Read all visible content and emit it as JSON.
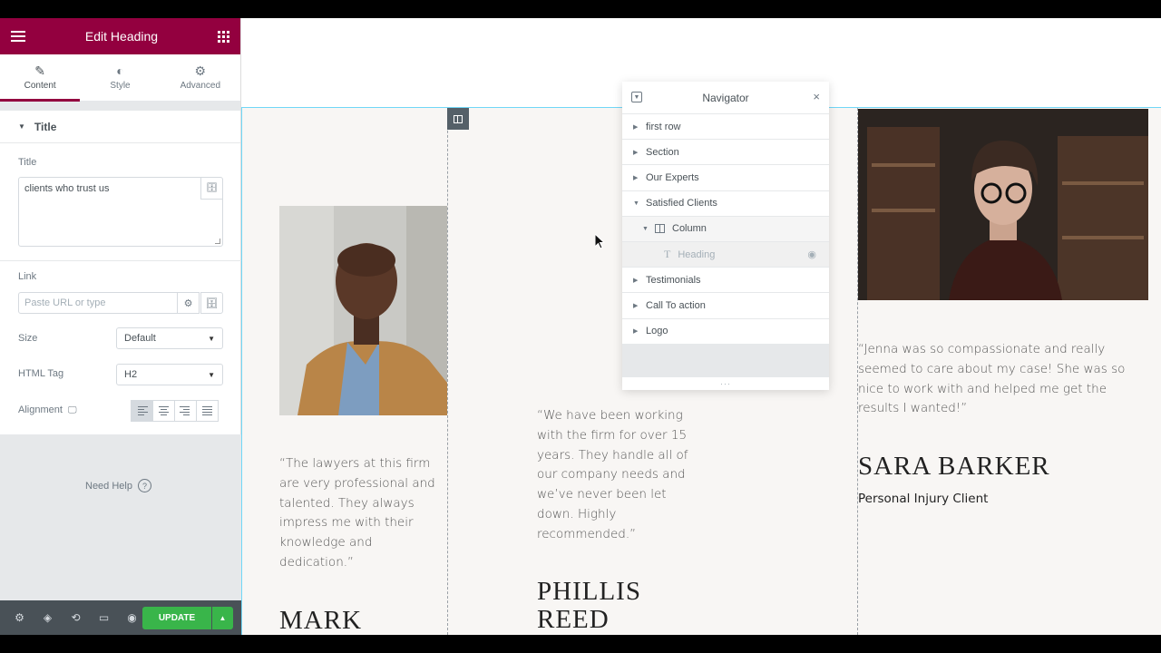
{
  "panel": {
    "title": "Edit Heading",
    "tabs": [
      {
        "label": "Content",
        "icon": "pencil-icon"
      },
      {
        "label": "Style",
        "icon": "half-circle-icon"
      },
      {
        "label": "Advanced",
        "icon": "gear-icon"
      }
    ],
    "section_title": "Title",
    "title_field": {
      "label": "Title",
      "value": "clients who trust us"
    },
    "link_field": {
      "label": "Link",
      "placeholder": "Paste URL or type"
    },
    "size": {
      "label": "Size",
      "value": "Default"
    },
    "html_tag": {
      "label": "HTML Tag",
      "value": "H2"
    },
    "alignment": {
      "label": "Alignment",
      "options": [
        "left",
        "center",
        "right",
        "justify"
      ],
      "active": "left"
    },
    "need_help": "Need Help",
    "update_label": "UPDATE",
    "accent_color": "#93003f",
    "update_color": "#39b54a"
  },
  "navigator": {
    "title": "Navigator",
    "items": [
      {
        "label": "first row",
        "expanded": false
      },
      {
        "label": "Section",
        "expanded": false
      },
      {
        "label": "Our Experts",
        "expanded": false
      },
      {
        "label": "Satisfied Clients",
        "expanded": true
      },
      {
        "label": "Column",
        "expanded": true
      },
      {
        "label": "Heading",
        "hidden": true
      },
      {
        "label": "Testimonials",
        "expanded": false
      },
      {
        "label": "Call To action",
        "expanded": false
      },
      {
        "label": "Logo",
        "expanded": false
      }
    ]
  },
  "testimonials": [
    {
      "quote": "“The lawyers at this firm are very professional and talented. They always impress me with their knowledge and dedication.”",
      "name": "MARK"
    },
    {
      "quote": "“We have been working with the firm for over 15 years. They handle all of our company needs and we’ve never been let down. Highly recommended.”",
      "name_line1": "PHILLIS",
      "name_line2": "REED"
    },
    {
      "quote": "“Jenna was so compassionate and really seemed to care about my case! She was so nice to work with and helped me get the results I wanted!”",
      "name": "SARA BARKER",
      "role": "Personal Injury Client"
    }
  ]
}
